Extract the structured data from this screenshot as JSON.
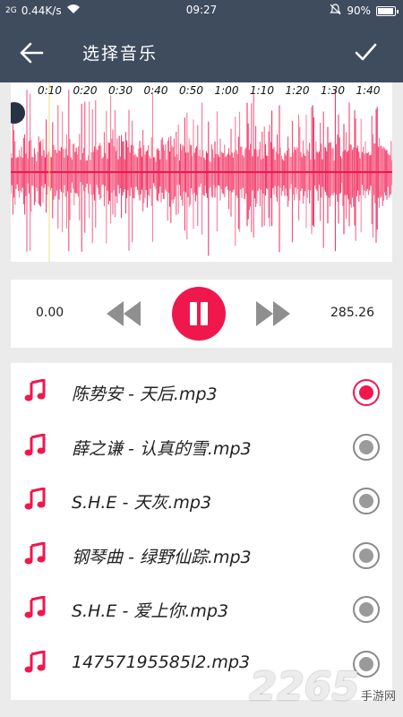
{
  "status_bar": {
    "signal": "2G",
    "speed": "0.44K/s",
    "time": "09:27",
    "battery": "90%"
  },
  "app_bar": {
    "title": "选择音乐"
  },
  "waveform": {
    "time_marks": [
      "0:10",
      "0:20",
      "0:30",
      "0:40",
      "0:50",
      "1:00",
      "1:10",
      "1:20",
      "1:30",
      "1:40"
    ],
    "color": "#f0174d"
  },
  "player": {
    "start_time": "0.00",
    "end_time": "285.26",
    "state": "playing"
  },
  "songs": [
    {
      "name": "陈势安 - 天后.mp3",
      "selected": true
    },
    {
      "name": "薛之谦 - 认真的雪.mp3",
      "selected": false
    },
    {
      "name": "S.H.E - 天灰.mp3",
      "selected": false
    },
    {
      "name": "钢琴曲 - 绿野仙踪.mp3",
      "selected": false
    },
    {
      "name": "S.H.E - 爱上你.mp3",
      "selected": false
    },
    {
      "name": "14757195585l2.mp3",
      "selected": false
    }
  ],
  "watermark": {
    "number": "2265",
    "suffix": "手游网"
  }
}
